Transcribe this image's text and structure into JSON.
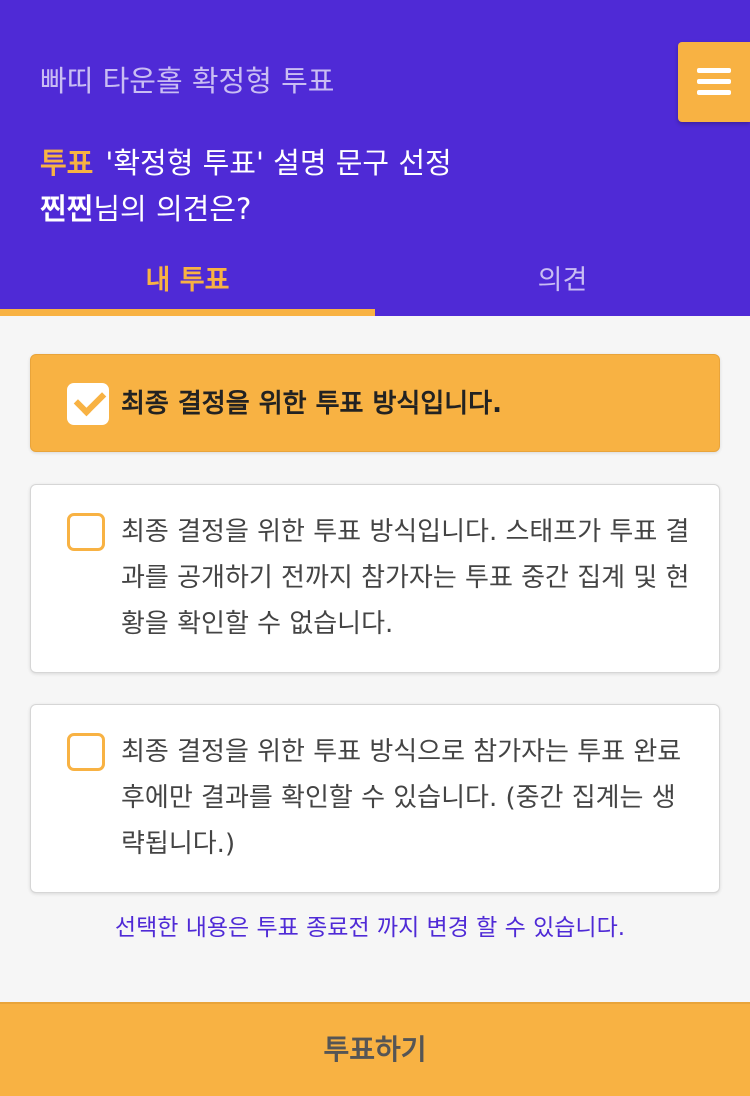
{
  "header": {
    "app_title": "빠띠 타운홀 확정형 투표",
    "vote_tag": "투표",
    "question_title": "'확정형 투표' 설명 문구 선정",
    "nickname": "찐찐",
    "question_suffix": "님의 의견은?",
    "menu_icon": "hamburger-menu-icon"
  },
  "tabs": [
    {
      "label": "내 투표",
      "active": true
    },
    {
      "label": "의견",
      "active": false
    }
  ],
  "options": [
    {
      "text": "최종 결정을 위한 투표 방식입니다.",
      "selected": true
    },
    {
      "text": "최종 결정을 위한 투표 방식입니다. 스태프가 투표 결과를 공개하기 전까지 참가자는 투표 중간 집계 및 현황을 확인할 수 없습니다.",
      "selected": false
    },
    {
      "text": "최종 결정을 위한 투표 방식으로 참가자는 투표 완료 후에만 결과를 확인할 수 있습니다. (중간 집계는 생략됩니다.)",
      "selected": false
    }
  ],
  "notice": "선택한 내용은 투표 종료전 까지 변경 할 수 있습니다.",
  "submit_label": "투표하기",
  "colors": {
    "header_bg": "#4f2ad6",
    "accent": "#f8b243",
    "tab_inactive": "#c9bdf3"
  }
}
